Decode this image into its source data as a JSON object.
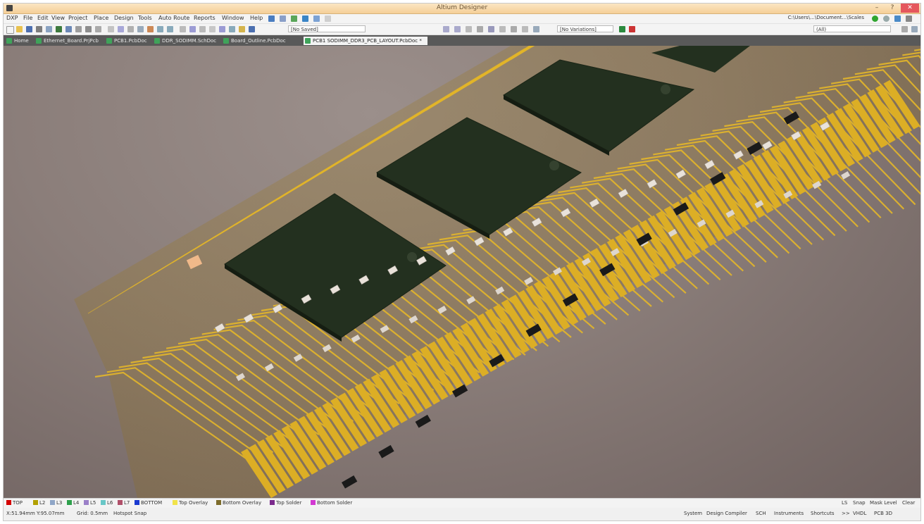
{
  "window": {
    "title": "Altium Designer",
    "min": "–",
    "max": "?",
    "close": "✕"
  },
  "menu": [
    "DXP",
    "File",
    "Edit",
    "View",
    "Project",
    "Place",
    "Design",
    "Tools",
    "Auto Route",
    "Reports",
    "Window",
    "Help"
  ],
  "toolbar": {
    "variant_combo": "[No Saved]",
    "view_combo": "[No Variations]",
    "path": "C:\\Users\\...\\Document...\\Scales",
    "zoom_combo": "(All)"
  },
  "tabs": [
    {
      "label": "Home"
    },
    {
      "label": "Ethernet_Board.PrjPcb"
    },
    {
      "label": "PCB1.PcbDoc"
    },
    {
      "label": "DDR_SODIMM.SchDoc"
    },
    {
      "label": "Board_Outline.PcbDoc"
    },
    {
      "label": "PCB1 SODIMM_DDR3_PCB_LAYOUT.PcbDoc *"
    }
  ],
  "layers": [
    {
      "label": "TOP",
      "color": "#d40000"
    },
    {
      "label": "L2",
      "color": "#b2a000"
    },
    {
      "label": "L3",
      "color": "#8fa6c7"
    },
    {
      "label": "L4",
      "color": "#2ea04c"
    },
    {
      "label": "L5",
      "color": "#9b80c8"
    },
    {
      "label": "L6",
      "color": "#68c7c7"
    },
    {
      "label": "L7",
      "color": "#b0506a"
    },
    {
      "label": "BOTTOM",
      "color": "#1a3ad0"
    },
    {
      "label": "Top Overlay",
      "color": "#f1e34a"
    },
    {
      "label": "Bottom Overlay",
      "color": "#7d6c2b"
    },
    {
      "label": "Top Solder",
      "color": "#7b2a8c"
    },
    {
      "label": "Bottom Solder",
      "color": "#d238d2"
    }
  ],
  "layerbar_right": [
    "LS",
    "Snap",
    "Mask Level",
    "Clear"
  ],
  "status": {
    "coords": "X:51.94mm Y:95.07mm",
    "grid": "Grid: 0.5mm",
    "mode": "Hotspot Snap",
    "right_items": [
      "System",
      "Design Compiler",
      "SCH",
      "Instruments",
      "Shortcuts",
      ">>",
      "VHDL",
      "PCB 3D"
    ]
  }
}
